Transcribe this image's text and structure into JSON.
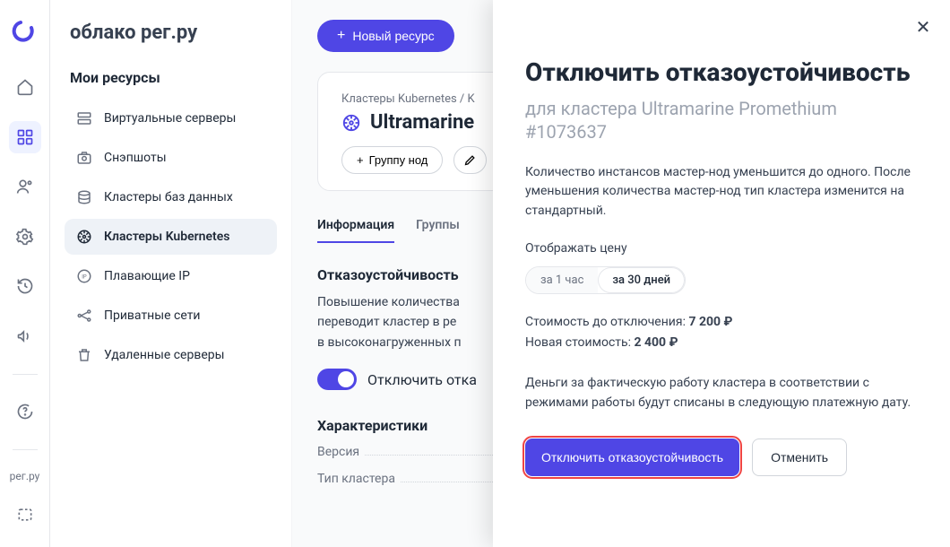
{
  "brand": {
    "product_title": "облако рег.ру",
    "footer_label": "рег.ру"
  },
  "new_resource_button": "Новый ресурс",
  "sidebar": {
    "section_title": "Мои ресурсы",
    "items": [
      {
        "label": "Виртуальные серверы"
      },
      {
        "label": "Снэпшоты"
      },
      {
        "label": "Кластеры баз данных"
      },
      {
        "label": "Кластеры Kubernetes"
      },
      {
        "label": "Плавающие IP"
      },
      {
        "label": "Приватные сети"
      },
      {
        "label": "Удаленные серверы"
      }
    ]
  },
  "main": {
    "breadcrumbs": "Кластеры Kubernetes / K",
    "cluster_name": "Ultramarine",
    "group_button": "Группу нод",
    "tabs": {
      "info": "Информация",
      "groups": "Группы"
    },
    "ha": {
      "heading": "Отказоустойчивость",
      "desc_line1": "Повышение количества",
      "desc_line2": "переводит кластер в ре",
      "desc_line3": "в высоконагруженных п",
      "toggle_label": "Отключить отка"
    },
    "chars": {
      "heading": "Характеристики",
      "version_label": "Версия",
      "type_label": "Тип кластера"
    }
  },
  "modal": {
    "title": "Отключить отказоустойчивость",
    "subtitle": "для кластера Ultramarine Promethium #1073637",
    "paragraph": "Количество инстансов мастер-нод уменьшится до одного. После уменьшения количества мастер-нод тип кластера изменится на стандартный.",
    "price_display_label": "Отображать цену",
    "period_options": {
      "hour": "за 1 час",
      "month": "за 30 дней"
    },
    "cost_before_label": "Стоимость до отключения: ",
    "cost_before_value": "7 200 ₽",
    "cost_after_label": "Новая стоимость: ",
    "cost_after_value": "2 400 ₽",
    "note": "Деньги за фактическую работу кластера в соответствии с режимами работы будут списаны в следующую платежную дату.",
    "confirm_button": "Отключить отказоустойчивость",
    "cancel_button": "Отменить"
  }
}
